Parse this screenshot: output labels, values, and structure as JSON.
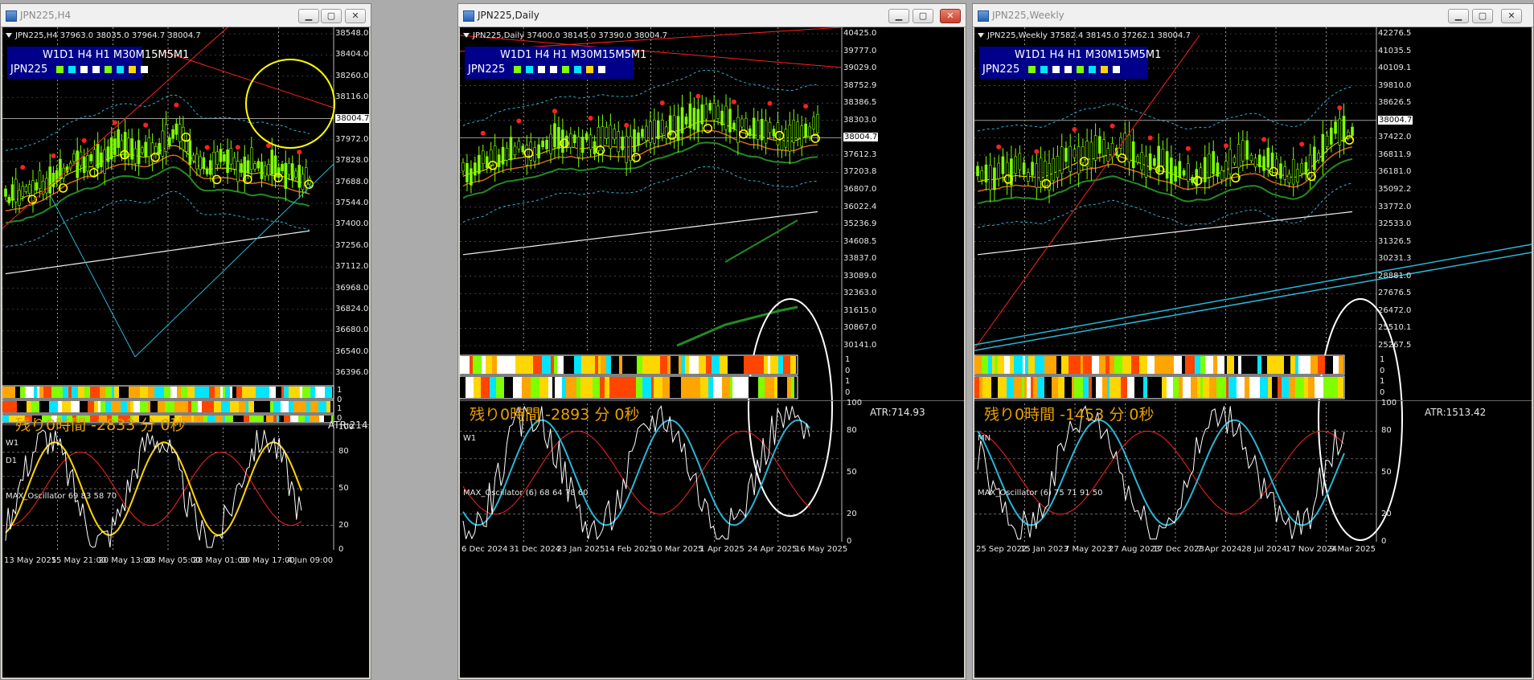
{
  "windows": [
    {
      "title": "JPN225,H4",
      "active": false,
      "header": "JPN225,H4  37963.0 38035.0 37964.7 38004.7",
      "tf_labels": "W1D1 H4 H1 M30M15M5M1",
      "symbol": "JPN225",
      "remaining": "残り0時間 -2833 分 0秒",
      "atr": "ATR:214.7",
      "price_labels": [
        "38548.0",
        "38404.0",
        "38260.0",
        "38116.0",
        "38004.7",
        "37972.0",
        "37828.0",
        "37688.0",
        "37544.0",
        "37400.0",
        "37256.0",
        "37112.0",
        "36968.0",
        "36824.0",
        "36680.0",
        "36540.0",
        "36396.0"
      ],
      "ind_rows": [
        "W1",
        "D1"
      ],
      "ind_scale": [
        "1",
        "0",
        "1",
        "0"
      ],
      "osc_label": "MAX_Oscillator 69 83 58 70",
      "osc_levels": [
        "100",
        "80",
        "50",
        "20",
        "0"
      ],
      "dates": [
        "13 May 2025",
        "15 May 21:00",
        "20 May 13:00",
        "23 May 05:00",
        "28 May 01:00",
        "30 May 17:00",
        "4 Jun 09:00"
      ]
    },
    {
      "title": "JPN225,Daily",
      "active": true,
      "header": "JPN225,Daily  37400.0 38145.0 37390.0 38004.7",
      "tf_labels": "W1D1 H4 H1 M30M15M5M1",
      "symbol": "JPN225",
      "remaining": "残り0時間 -2893 分 0秒",
      "atr": "ATR:714.93",
      "price_labels": [
        "40425.0",
        "39777.0",
        "39029.0",
        "38752.9",
        "38386.5",
        "38303.0",
        "38004.7",
        "37612.3",
        "37203.8",
        "36807.0",
        "36022.4",
        "35236.9",
        "34608.5",
        "33837.0",
        "33089.0",
        "32363.0",
        "31615.0",
        "30867.0",
        "30141.0"
      ],
      "ind_rows": [
        "W1",
        ""
      ],
      "ind_scale": [
        "1",
        "0",
        "1",
        "0"
      ],
      "osc_label": "MAX_Oscillator (6) 68 64 78 60",
      "osc_levels": [
        "100",
        "80",
        "50",
        "20",
        "0"
      ],
      "dates": [
        "6 Dec 2024",
        "31 Dec 2024",
        "23 Jan 2025",
        "14 Feb 2025",
        "10 Mar 2025",
        "1 Apr 2025",
        "24 Apr 2025",
        "16 May 2025"
      ]
    },
    {
      "title": "JPN225,Weekly",
      "active": false,
      "header": "JPN225,Weekly  37582.4 38145.0 37262.1 38004.7",
      "tf_labels": "W1D1 H4 H1 M30M15M5M1",
      "symbol": "JPN225",
      "remaining": "残り0時間 -1453 分 0秒",
      "atr": "ATR:1513.42",
      "price_labels": [
        "42276.5",
        "41035.5",
        "40109.1",
        "39810.0",
        "38626.5",
        "38004.7",
        "37422.0",
        "36811.9",
        "36181.0",
        "35092.2",
        "33772.0",
        "32533.0",
        "31326.5",
        "30231.3",
        "28881.0",
        "27676.5",
        "26472.0",
        "25510.1",
        "25267.5"
      ],
      "ind_rows": [
        "MN",
        ""
      ],
      "ind_scale": [
        "1",
        "0",
        "1",
        "0"
      ],
      "osc_label": "MAX_Oscillator (6) 75 71 91 50",
      "osc_levels": [
        "100",
        "80",
        "50",
        "20",
        "0"
      ],
      "dates": [
        "25 Sep 2022",
        "15 Jan 2023",
        "7 May 2023",
        "27 Aug 2023",
        "17 Dec 2023",
        "7 Apr 2024",
        "28 Jul 2024",
        "17 Nov 2024",
        "9 Mar 2025"
      ]
    }
  ],
  "colors": {
    "chart_bg": "#000000",
    "candle": "#7fff00",
    "tf_box": "#00008b",
    "remaining_text": "#e8a000",
    "highlight_circle_h4": "#ffff00",
    "highlight_circle_other": "#ffffff"
  },
  "icons": [
    "chart-window-icon",
    "minimize-icon",
    "maximize-icon",
    "close-icon"
  ]
}
